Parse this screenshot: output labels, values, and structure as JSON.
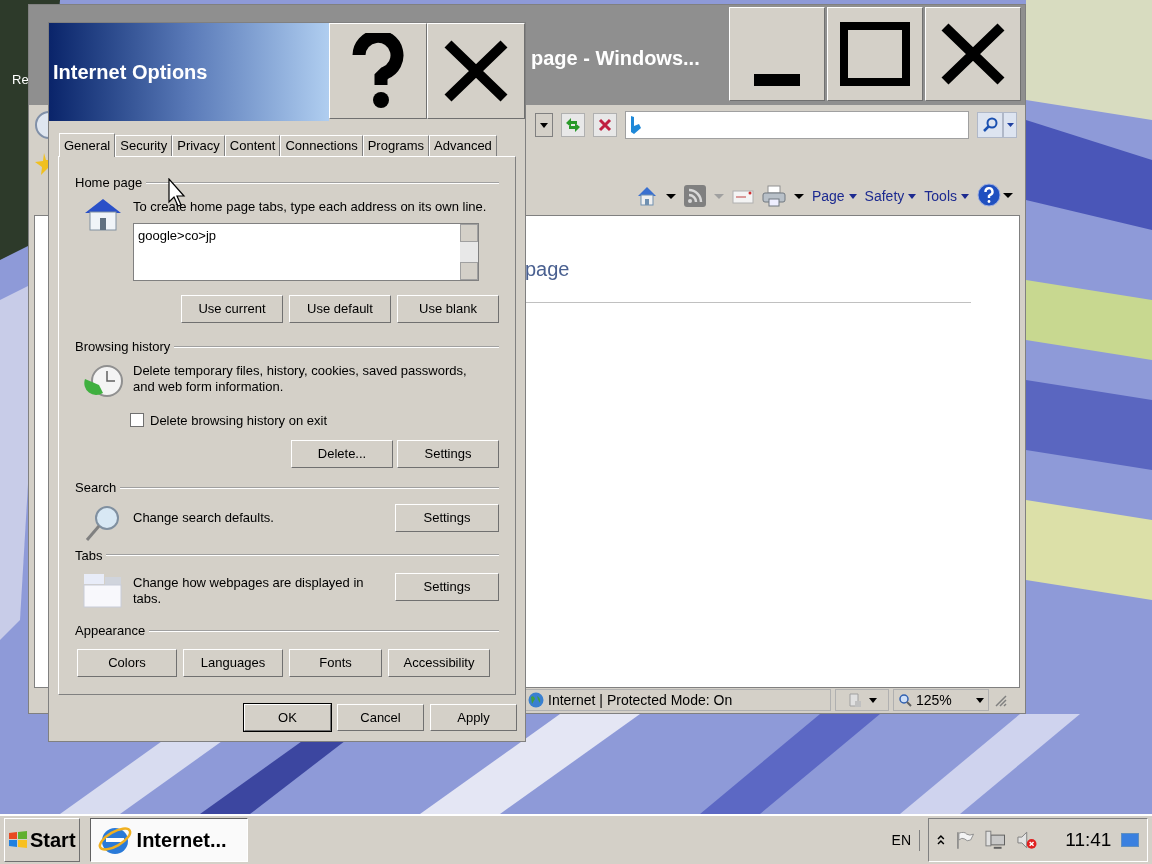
{
  "desktop": {
    "icon_label": "Re"
  },
  "browser": {
    "title": "page - Windows...",
    "command_bar": [
      {
        "label": "Page"
      },
      {
        "label": "Safety"
      },
      {
        "label": "Tools"
      }
    ],
    "page_heading": "page",
    "status": {
      "zone": "Internet | Protected Mode: On",
      "zoom": "125%"
    }
  },
  "dialog": {
    "title": "Internet Options",
    "tabs": [
      {
        "label": "General",
        "selected": true
      },
      {
        "label": "Security",
        "selected": false
      },
      {
        "label": "Privacy",
        "selected": false
      },
      {
        "label": "Content",
        "selected": false
      },
      {
        "label": "Connections",
        "selected": false
      },
      {
        "label": "Programs",
        "selected": false
      },
      {
        "label": "Advanced",
        "selected": false
      }
    ],
    "home_page": {
      "heading": "Home page",
      "description": "To create home page tabs, type each address on its own line.",
      "value": "google>co>jp",
      "buttons": [
        "Use current",
        "Use default",
        "Use blank"
      ]
    },
    "browsing_history": {
      "heading": "Browsing history",
      "description": "Delete temporary files, history, cookies, saved passwords, and web form information.",
      "checkbox": {
        "label": "Delete browsing history on exit",
        "checked": false
      },
      "buttons": [
        "Delete...",
        "Settings"
      ]
    },
    "search": {
      "heading": "Search",
      "description": "Change search defaults.",
      "button": "Settings"
    },
    "tabs_section": {
      "heading": "Tabs",
      "description": "Change how webpages are displayed in tabs.",
      "button": "Settings"
    },
    "appearance": {
      "heading": "Appearance",
      "buttons": [
        "Colors",
        "Languages",
        "Fonts",
        "Accessibility"
      ]
    },
    "footer_buttons": [
      {
        "label": "OK",
        "default": true
      },
      {
        "label": "Cancel",
        "default": false
      },
      {
        "label": "Apply",
        "default": false
      }
    ]
  },
  "taskbar": {
    "start": "Start",
    "tasks": [
      {
        "label": "Internet...",
        "selected": true
      }
    ],
    "language": "EN",
    "clock": "11:41"
  }
}
